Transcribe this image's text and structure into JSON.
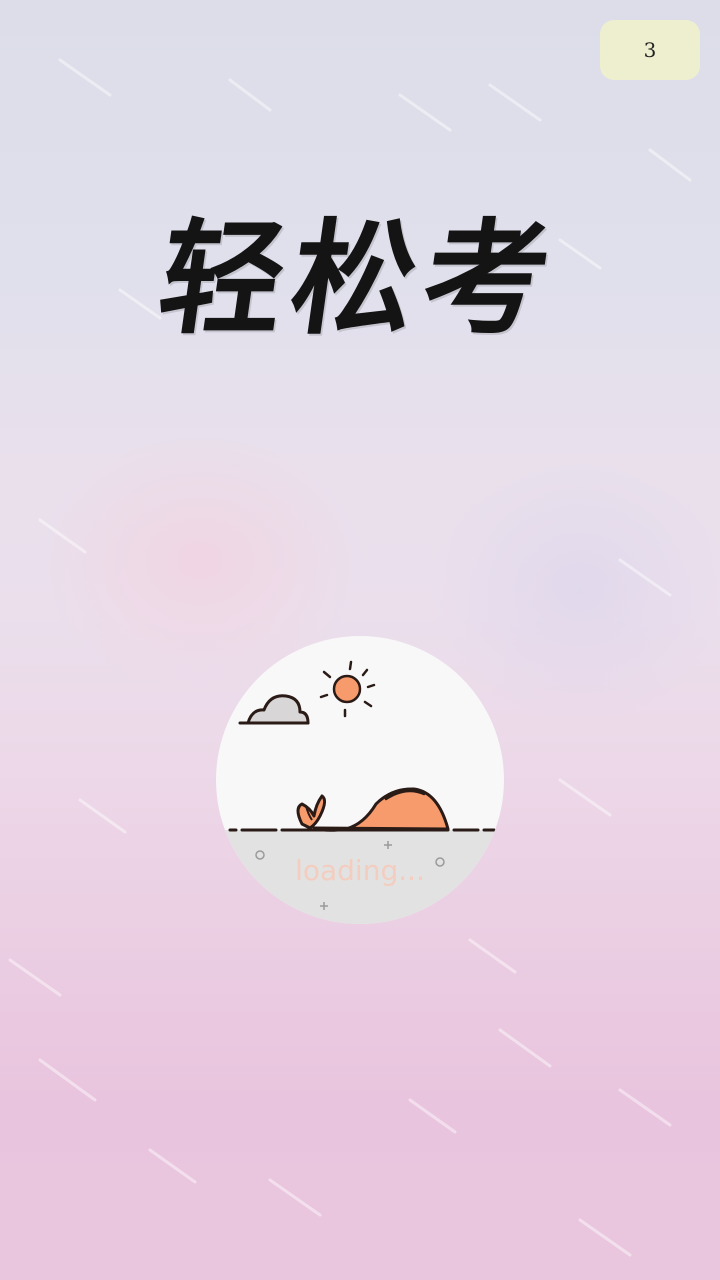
{
  "countdown": {
    "value": "3"
  },
  "app": {
    "title": "轻松考"
  },
  "loader": {
    "text": "loading...",
    "illustration_icons": [
      "sun-icon",
      "cloud-icon",
      "whale-icon"
    ]
  },
  "colors": {
    "countdown_bg": "#eeefcf",
    "title": "#141414",
    "whale": "#f89b6c",
    "sun": "#f89b6c",
    "loading_text": "#f3cdbf",
    "circle_bg": "#f8f8f8",
    "ground": "#e2e2e2"
  }
}
